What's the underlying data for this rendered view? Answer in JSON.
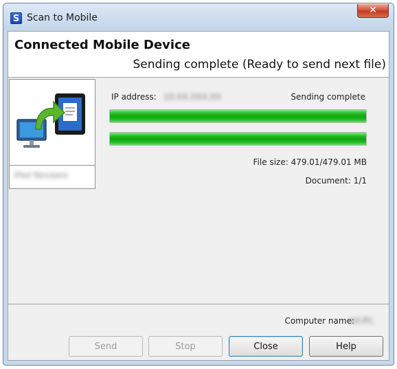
{
  "window": {
    "title": "Scan to Mobile",
    "app_icon_glyph": "S",
    "close_glyph": "✕"
  },
  "header": {
    "title": "Connected Mobile Device",
    "status": "Sending complete (Ready to send next file)"
  },
  "device": {
    "name": "iPad Novaaro"
  },
  "transfer": {
    "ip_label": "IP address:",
    "ip_value": "10.XX.XXX.XX",
    "status": "Sending complete",
    "progress_1_percent": 100,
    "progress_2_percent": 100,
    "file_size": "File size: 479.01/479.01 MB",
    "document": "Document: 1/1"
  },
  "footer": {
    "computer_name_label": "Computer name:",
    "computer_name_value": "XX-PC"
  },
  "buttons": {
    "send": "Send",
    "stop": "Stop",
    "close": "Close",
    "help": "Help"
  },
  "colors": {
    "progress_fill": "#10a810",
    "accent_blue": "#3c7fb1",
    "arrow_green": "#5cb531"
  }
}
